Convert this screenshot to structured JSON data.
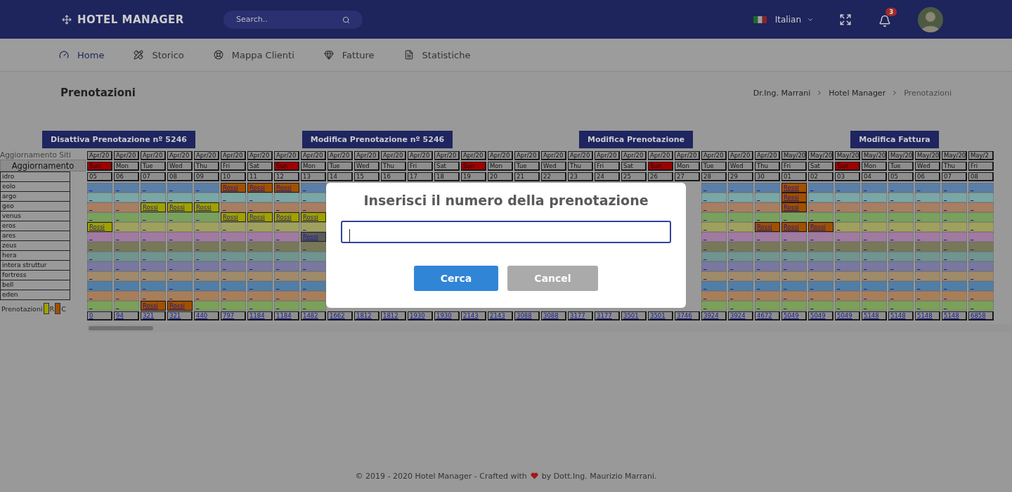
{
  "header": {
    "brand": "HOTEL MANAGER",
    "search": {
      "placeholder": "Search.."
    },
    "language": "Italian",
    "notifications": "3"
  },
  "nav": [
    {
      "label": "Home",
      "selected": true
    },
    {
      "label": "Storico",
      "selected": false
    },
    {
      "label": "Mappa Clienti",
      "selected": false
    },
    {
      "label": "Fatture",
      "selected": false
    },
    {
      "label": "Statistiche",
      "selected": false
    }
  ],
  "page_title": "Prenotazioni",
  "breadcrumb": [
    "Dr.Ing. Marrani",
    "Hotel Manager",
    "Prenotazioni"
  ],
  "actions": [
    "Disattiva Prenotazione nº 5246",
    "Modifica Prenotazione nº 5246",
    "Modifica Prenotazione",
    "Modifica Fattura"
  ],
  "sidebar": {
    "title": "Aggiornamento Siti",
    "button": "Aggiornamento",
    "legend_label": "Prenotazioni",
    "legend": [
      {
        "label": "R",
        "kind": "reserved"
      },
      {
        "label": "C",
        "kind": "confirmed"
      }
    ]
  },
  "columns": [
    {
      "month": "Apr/20",
      "weekday": "Sun",
      "day": "05",
      "highlighted": true,
      "total": "0"
    },
    {
      "month": "Apr/20",
      "weekday": "Mon",
      "day": "06",
      "highlighted": false,
      "total": "94"
    },
    {
      "month": "Apr/20",
      "weekday": "Tue",
      "day": "07",
      "highlighted": false,
      "total": "321"
    },
    {
      "month": "Apr/20",
      "weekday": "Wed",
      "day": "08",
      "highlighted": false,
      "total": "321"
    },
    {
      "month": "Apr/20",
      "weekday": "Thu",
      "day": "09",
      "highlighted": false,
      "total": "440"
    },
    {
      "month": "Apr/20",
      "weekday": "Fri",
      "day": "10",
      "highlighted": false,
      "total": "797"
    },
    {
      "month": "Apr/20",
      "weekday": "Sat",
      "day": "11",
      "highlighted": false,
      "total": "1184"
    },
    {
      "month": "Apr/20",
      "weekday": "Sun",
      "day": "12",
      "highlighted": true,
      "total": "1184"
    },
    {
      "month": "Apr/20",
      "weekday": "Mon",
      "day": "13",
      "highlighted": false,
      "total": "1482"
    },
    {
      "month": "Apr/20",
      "weekday": "Tue",
      "day": "14",
      "highlighted": false,
      "total": "1662"
    },
    {
      "month": "Apr/20",
      "weekday": "Wed",
      "day": "15",
      "highlighted": false,
      "total": "1812"
    },
    {
      "month": "Apr/20",
      "weekday": "Thu",
      "day": "16",
      "highlighted": false,
      "total": "1812"
    },
    {
      "month": "Apr/20",
      "weekday": "Fri",
      "day": "17",
      "highlighted": false,
      "total": "1930"
    },
    {
      "month": "Apr/20",
      "weekday": "Sat",
      "day": "18",
      "highlighted": false,
      "total": "1930"
    },
    {
      "month": "Apr/20",
      "weekday": "Sun",
      "day": "19",
      "highlighted": true,
      "total": "2143"
    },
    {
      "month": "Apr/20",
      "weekday": "Mon",
      "day": "20",
      "highlighted": false,
      "total": "2143"
    },
    {
      "month": "Apr/20",
      "weekday": "Tue",
      "day": "21",
      "highlighted": false,
      "total": "3088"
    },
    {
      "month": "Apr/20",
      "weekday": "Wed",
      "day": "22",
      "highlighted": false,
      "total": "3088"
    },
    {
      "month": "Apr/20",
      "weekday": "Thu",
      "day": "23",
      "highlighted": false,
      "total": "3177"
    },
    {
      "month": "Apr/20",
      "weekday": "Fri",
      "day": "24",
      "highlighted": false,
      "total": "3177"
    },
    {
      "month": "Apr/20",
      "weekday": "Sat",
      "day": "25",
      "highlighted": false,
      "total": "3501"
    },
    {
      "month": "Apr/20",
      "weekday": "Sun",
      "day": "26",
      "highlighted": true,
      "total": "3501"
    },
    {
      "month": "Apr/20",
      "weekday": "Mon",
      "day": "27",
      "highlighted": false,
      "total": "3746"
    },
    {
      "month": "Apr/20",
      "weekday": "Tue",
      "day": "28",
      "highlighted": false,
      "total": "3924"
    },
    {
      "month": "Apr/20",
      "weekday": "Wed",
      "day": "29",
      "highlighted": false,
      "total": "3924"
    },
    {
      "month": "Apr/20",
      "weekday": "Thu",
      "day": "30",
      "highlighted": false,
      "total": "4672"
    },
    {
      "month": "May/20",
      "weekday": "Fri",
      "day": "01",
      "highlighted": false,
      "total": "5049"
    },
    {
      "month": "May/20",
      "weekday": "Sat",
      "day": "02",
      "highlighted": false,
      "total": "5049"
    },
    {
      "month": "May/20",
      "weekday": "Sun",
      "day": "03",
      "highlighted": true,
      "total": "5049"
    },
    {
      "month": "May/20",
      "weekday": "Mon",
      "day": "04",
      "highlighted": false,
      "total": "5148"
    },
    {
      "month": "May/20",
      "weekday": "Tue",
      "day": "05",
      "highlighted": false,
      "total": "5148"
    },
    {
      "month": "May/20",
      "weekday": "Wed",
      "day": "06",
      "highlighted": false,
      "total": "5148"
    },
    {
      "month": "May/20",
      "weekday": "Thu",
      "day": "07",
      "highlighted": false,
      "total": "5148"
    },
    {
      "month": "May/2",
      "weekday": "Fri",
      "day": "08",
      "highlighted": false,
      "total": "6858"
    }
  ],
  "rooms": [
    {
      "name": "idro",
      "color": "#5a7ea6",
      "cells": [
        "_",
        "_",
        "_",
        "_",
        "_",
        {
          "guest": "Rossi",
          "kind": "confirmed"
        },
        {
          "guest": "Rossi",
          "kind": "confirmed"
        },
        {
          "guest": "Rossi",
          "kind": "confirmed"
        },
        "_",
        null,
        null,
        null,
        null,
        null,
        null,
        null,
        null,
        null,
        null,
        null,
        null,
        null,
        null,
        "_",
        "_",
        "_",
        {
          "guest": "Rossi",
          "kind": "confirmed"
        },
        "_",
        "_",
        "_",
        "_",
        "_",
        "_",
        "_"
      ]
    },
    {
      "name": "eolo",
      "color": "#7aa6a6",
      "cells": [
        "_",
        "_",
        "_",
        "_",
        "_",
        "_",
        "_",
        "_",
        "_",
        null,
        null,
        null,
        null,
        null,
        null,
        null,
        null,
        null,
        null,
        null,
        null,
        null,
        null,
        "_",
        "_",
        "_",
        {
          "guest": "Rossi",
          "kind": "confirmed"
        },
        "_",
        "_",
        "_",
        "_",
        "_",
        "_",
        "_"
      ]
    },
    {
      "name": "argo",
      "color": "#a87e62",
      "cells": [
        "_",
        "_",
        {
          "guest": "Rossi",
          "kind": "reserved"
        },
        {
          "guest": "Rossi",
          "kind": "reserved"
        },
        {
          "guest": "Rossi",
          "kind": "reserved"
        },
        "_",
        "_",
        "_",
        "_",
        null,
        null,
        null,
        null,
        null,
        null,
        null,
        null,
        null,
        null,
        null,
        null,
        null,
        null,
        "_",
        "_",
        "_",
        {
          "guest": "Rossi",
          "kind": "confirmed"
        },
        "_",
        "_",
        "_",
        "_",
        "_",
        "_",
        "_"
      ]
    },
    {
      "name": "geo",
      "color": "#7aa05e",
      "cells": [
        "_",
        "_",
        "_",
        "_",
        "_",
        {
          "guest": "Rossi",
          "kind": "reserved"
        },
        {
          "guest": "Rossi",
          "kind": "reserved"
        },
        {
          "guest": "Rossi",
          "kind": "reserved"
        },
        {
          "guest": "Rossi",
          "kind": "reserved"
        },
        null,
        null,
        null,
        null,
        null,
        null,
        null,
        null,
        null,
        null,
        null,
        null,
        null,
        null,
        "_",
        "_",
        "_",
        "_",
        "_",
        "_",
        "_",
        "_",
        "_",
        "_",
        "_"
      ]
    },
    {
      "name": "venus",
      "color": "#a0a05e",
      "cells": [
        {
          "guest": "Rossi",
          "kind": "reserved"
        },
        "_",
        "_",
        "_",
        "_",
        "_",
        "_",
        "_",
        "_",
        null,
        null,
        null,
        null,
        null,
        null,
        null,
        null,
        null,
        null,
        null,
        null,
        null,
        null,
        "_",
        "_",
        {
          "guest": "Rossi",
          "kind": "confirmed"
        },
        {
          "guest": "Rossi",
          "kind": "confirmed"
        },
        {
          "guest": "Rossi",
          "kind": "confirmed"
        },
        "_",
        "_",
        "_",
        "_",
        "_",
        "_"
      ]
    },
    {
      "name": "eros",
      "color": "#a07aa0",
      "cells": [
        "_",
        "_",
        "_",
        "_",
        "_",
        "_",
        "_",
        "_",
        {
          "guest": "Rossi",
          "kind": "other"
        },
        null,
        null,
        null,
        null,
        null,
        null,
        null,
        null,
        null,
        null,
        null,
        null,
        null,
        null,
        "_",
        "_",
        "_",
        "_",
        "_",
        "_",
        "_",
        "_",
        "_",
        "_",
        "_"
      ]
    },
    {
      "name": "ares",
      "color": "#787858",
      "cells": [
        "_",
        "_",
        "_",
        "_",
        "_",
        "_",
        "_",
        "_",
        "_",
        null,
        null,
        null,
        null,
        null,
        null,
        null,
        null,
        null,
        null,
        null,
        null,
        null,
        null,
        "_",
        "_",
        "_",
        "_",
        "_",
        "_",
        "_",
        "_",
        "_",
        "_",
        "_"
      ]
    },
    {
      "name": "zeus",
      "color": "#709490",
      "cells": [
        "_",
        "_",
        "_",
        "_",
        "_",
        "_",
        "_",
        "_",
        "_",
        null,
        null,
        null,
        null,
        null,
        null,
        null,
        null,
        null,
        null,
        null,
        null,
        null,
        null,
        "_",
        "_",
        "_",
        "_",
        "_",
        "_",
        "_",
        "_",
        "_",
        "_",
        "_"
      ]
    },
    {
      "name": "hera",
      "color": "#7878a0",
      "cells": [
        "_",
        "_",
        "_",
        "_",
        "_",
        "_",
        "_",
        "_",
        "_",
        null,
        null,
        null,
        null,
        null,
        null,
        null,
        null,
        null,
        null,
        null,
        null,
        null,
        null,
        "_",
        "_",
        "_",
        "_",
        "_",
        "_",
        "_",
        "_",
        "_",
        "_",
        "_"
      ]
    },
    {
      "name": "intera struttur",
      "color": "#a08a6a",
      "cells": [
        "_",
        "_",
        "_",
        "_",
        "_",
        "_",
        "_",
        "_",
        "_",
        null,
        null,
        null,
        null,
        null,
        null,
        null,
        null,
        null,
        null,
        null,
        null,
        null,
        null,
        "_",
        "_",
        "_",
        "_",
        "_",
        "_",
        "_",
        "_",
        "_",
        "_",
        "_"
      ]
    },
    {
      "name": "fortress",
      "color": "#507ea6",
      "cells": [
        "_",
        "_",
        "_",
        "_",
        "_",
        "_",
        "_",
        "_",
        "_",
        null,
        null,
        null,
        null,
        null,
        null,
        null,
        null,
        null,
        null,
        null,
        null,
        null,
        null,
        "_",
        "_",
        "_",
        "_",
        "_",
        "_",
        "_",
        "_",
        "_",
        "_",
        "_"
      ]
    },
    {
      "name": "bell",
      "color": "#a87e5a",
      "cells": [
        "_",
        "_",
        "_",
        "_",
        "_",
        "_",
        "_",
        "_",
        "_",
        null,
        null,
        null,
        null,
        null,
        null,
        null,
        null,
        null,
        null,
        null,
        null,
        null,
        null,
        "_",
        "_",
        "_",
        "_",
        "_",
        "_",
        "_",
        "_",
        "_",
        "_",
        "_"
      ]
    },
    {
      "name": "eden",
      "color": "#7aa05a",
      "cells": [
        "_",
        "_",
        {
          "guest": "Rossi",
          "kind": "confirmed"
        },
        {
          "guest": "Rossi",
          "kind": "confirmed"
        },
        "_",
        "_",
        "_",
        "_",
        "_",
        null,
        null,
        null,
        null,
        null,
        null,
        null,
        null,
        null,
        null,
        null,
        null,
        null,
        null,
        "_",
        "_",
        "_",
        "_",
        "_",
        "_",
        "_",
        "_",
        "_",
        "_",
        "_"
      ]
    }
  ],
  "dialog": {
    "title": "Inserisci il numero della prenotazione",
    "input": {
      "focused": true
    },
    "buttons": [
      {
        "label": "Cerca",
        "kind": "confirm"
      },
      {
        "label": "Cancel",
        "kind": "cancel"
      }
    ]
  },
  "footer": {
    "before": "© 2019 - 2020 Hotel Manager - Crafted with",
    "after": "by Dott.Ing. Maurizio Marrani."
  }
}
